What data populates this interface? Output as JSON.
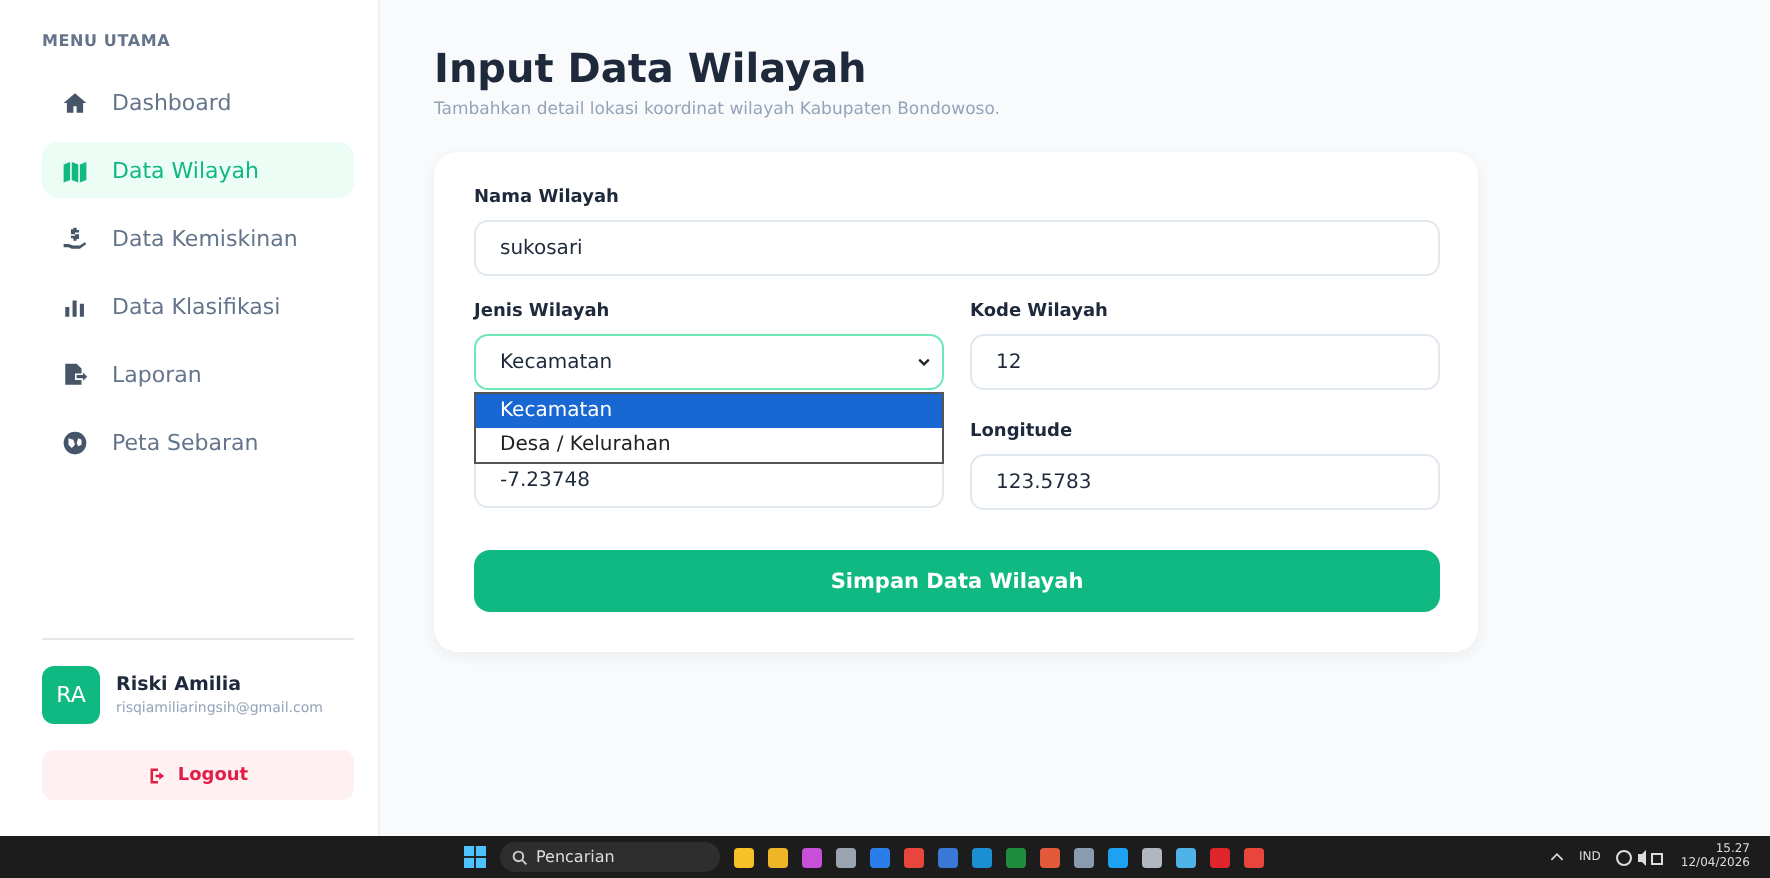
{
  "sidebar": {
    "heading": "MENU UTAMA",
    "items": [
      {
        "label": "Dashboard",
        "selected": false
      },
      {
        "label": "Data Wilayah",
        "selected": true
      },
      {
        "label": "Data Kemiskinan",
        "selected": false
      },
      {
        "label": "Data Klasifikasi",
        "selected": false
      },
      {
        "label": "Laporan",
        "selected": false
      },
      {
        "label": "Peta Sebaran",
        "selected": false
      }
    ],
    "user": {
      "initials": "RA",
      "name": "Riski Amilia",
      "email": "risqiamiliaringsih@gmail.com"
    },
    "logout": "Logout"
  },
  "page": {
    "title": "Input Data Wilayah",
    "subtitle": "Tambahkan detail lokasi koordinat wilayah Kabupaten Bondowoso."
  },
  "form": {
    "nama": {
      "label": "Nama Wilayah",
      "value": "sukosari"
    },
    "jenis": {
      "label": "Jenis Wilayah",
      "value": "Kecamatan",
      "expanded": true,
      "options": [
        {
          "label": "Kecamatan",
          "selected": true
        },
        {
          "label": "Desa / Kelurahan",
          "selected": false
        }
      ]
    },
    "kode": {
      "label": "Kode Wilayah",
      "value": "12"
    },
    "latitude": {
      "value": "-7.23748"
    },
    "longitude": {
      "label": "Longitude",
      "value": "123.5783"
    },
    "submit": "Simpan Data Wilayah"
  },
  "taskbar": {
    "search_placeholder": "Pencarian",
    "language": "IND",
    "time": "15.27",
    "date": "12/04/2026"
  }
}
